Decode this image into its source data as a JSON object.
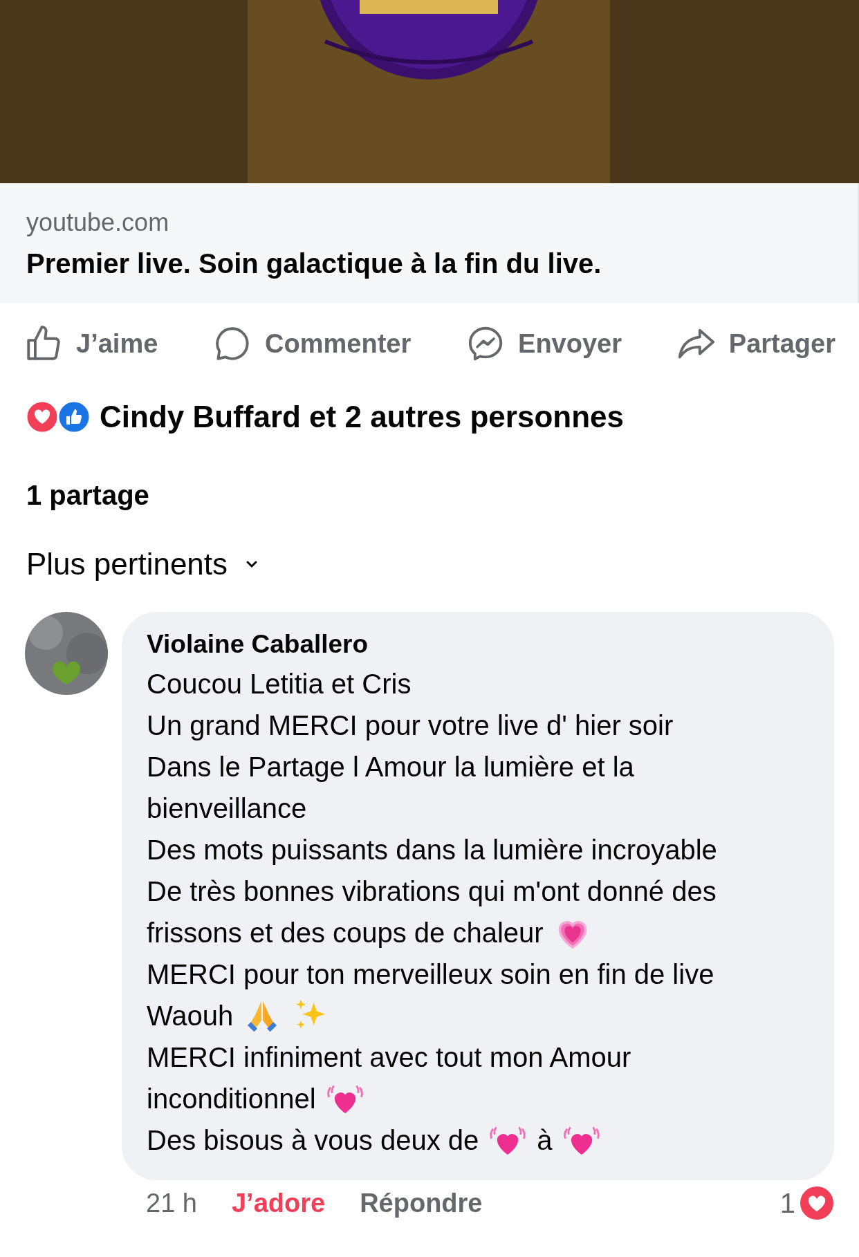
{
  "link_preview": {
    "domain": "youtube.com",
    "title": "Premier live. Soin galactique à la fin du live."
  },
  "actions": [
    {
      "kind": "like",
      "label": "J’aime"
    },
    {
      "kind": "comment",
      "label": "Commenter"
    },
    {
      "kind": "send",
      "label": "Envoyer"
    },
    {
      "kind": "share",
      "label": "Partager"
    }
  ],
  "reactions": {
    "summary": "Cindy Buffard et 2 autres personnes"
  },
  "shares": "1 partage",
  "sort": {
    "label": "Plus pertinents"
  },
  "comment": {
    "author": "Violaine Caballero",
    "lines": [
      [
        {
          "kind": "text",
          "text": "Coucou Letitia et Cris"
        }
      ],
      [
        {
          "kind": "text",
          "text": "Un grand MERCI pour votre live d' hier soir"
        }
      ],
      [
        {
          "kind": "text",
          "text": "Dans le Partage l Amour la lumière et la"
        }
      ],
      [
        {
          "kind": "text",
          "text": "bienveillance"
        }
      ],
      [
        {
          "kind": "text",
          "text": "Des mots puissants dans la lumière incroyable"
        }
      ],
      [
        {
          "kind": "text",
          "text": "De très bonnes vibrations qui m'ont donné des"
        }
      ],
      [
        {
          "kind": "text",
          "text": "frissons et des coups de chaleur"
        },
        {
          "kind": "sparkle-heart"
        }
      ],
      [
        {
          "kind": "text",
          "text": "MERCI pour ton merveilleux soin en fin de live"
        }
      ],
      [
        {
          "kind": "text",
          "text": "Waouh"
        },
        {
          "kind": "hands"
        },
        {
          "kind": "sparkles"
        }
      ],
      [
        {
          "kind": "text",
          "text": "MERCI infiniment avec tout mon Amour"
        }
      ],
      [
        {
          "kind": "text",
          "text": "inconditionnel"
        },
        {
          "kind": "beating-heart"
        }
      ],
      [
        {
          "kind": "text",
          "text": "Des bisous à vous deux de"
        },
        {
          "kind": "beating-heart"
        },
        {
          "kind": "text",
          "text": "à"
        },
        {
          "kind": "beating-heart"
        }
      ]
    ],
    "time": "21 h",
    "reaction_label": "J’adore",
    "reacted": true,
    "reply_label": "Répondre",
    "reaction_count": "1"
  }
}
